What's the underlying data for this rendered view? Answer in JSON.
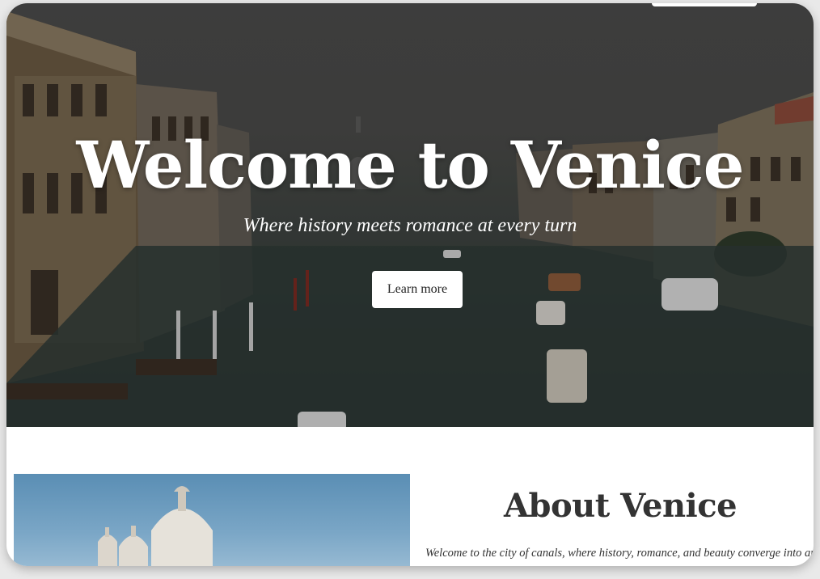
{
  "hero": {
    "title": "Welcome to Venice",
    "subtitle": "Where history meets romance at every turn",
    "button_label": "Learn more"
  },
  "about": {
    "title": "About Venice",
    "text": "Welcome to the city of canals, where history, romance, and beauty converge into an unforgettable experience. Discover fascinating islands"
  },
  "colors": {
    "hero_overlay": "#3d4340",
    "button_bg": "#ffffff",
    "heading_text": "#333333",
    "page_bg": "#ffffff"
  }
}
